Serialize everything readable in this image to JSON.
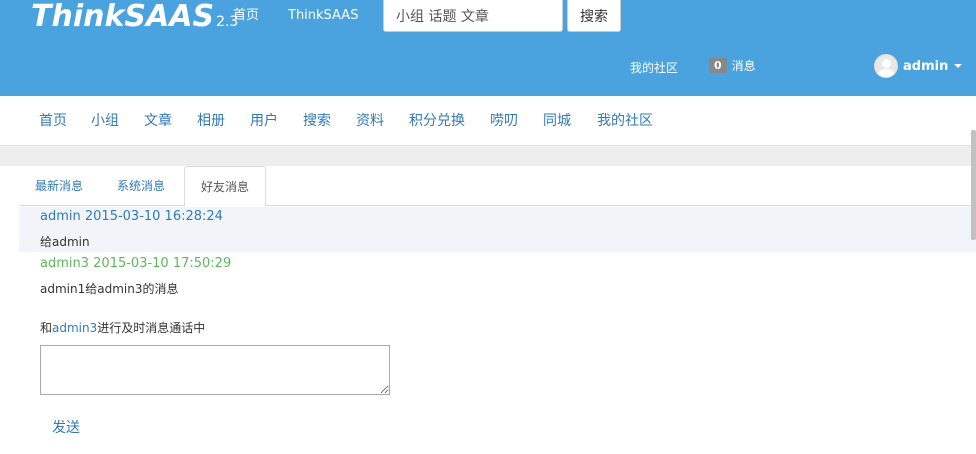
{
  "header": {
    "logo_text": "ThinkSAAS",
    "logo_version": "2.3",
    "links": {
      "home": "首页",
      "thinksaas": "ThinkSAAS"
    },
    "search": {
      "value": "小组 话题 文章",
      "button_label": "搜索"
    },
    "my_community": "我的社区",
    "messages": {
      "count": "0",
      "label": "消息"
    },
    "user": {
      "name": "admin"
    }
  },
  "nav": {
    "items": [
      "首页",
      "小组",
      "文章",
      "相册",
      "用户",
      "搜索",
      "资料",
      "积分兑换",
      "唠叨",
      "同城",
      "我的社区"
    ]
  },
  "tabs": [
    "最新消息",
    "系统消息",
    "好友消息"
  ],
  "active_tab": "好友消息",
  "messages": [
    {
      "sender": "admin",
      "time": "2015-03-10 16:28:24",
      "body": "给admin",
      "color": "#337ab7"
    },
    {
      "sender": "admin3",
      "time": "2015-03-10 17:50:29",
      "body": "admin1给admin3的消息",
      "color": "#5cb85c"
    }
  ],
  "chat": {
    "prefix": "和",
    "partner": "admin3",
    "suffix": "进行及时消息通话中",
    "send_label": "发送"
  },
  "colors": {
    "header_bg": "#4aa3df",
    "link": "#337ab7",
    "accent_green": "#5cb85c"
  }
}
